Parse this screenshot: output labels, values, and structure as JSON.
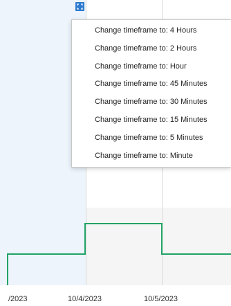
{
  "menu": {
    "items": [
      {
        "label": "Change timeframe to: 4 Hours"
      },
      {
        "label": "Change timeframe to: 2 Hours"
      },
      {
        "label": "Change timeframe to: Hour"
      },
      {
        "label": "Change timeframe to: 45 Minutes"
      },
      {
        "label": "Change timeframe to: 30 Minutes"
      },
      {
        "label": "Change timeframe to: 15 Minutes"
      },
      {
        "label": "Change timeframe to: 5 Minutes"
      },
      {
        "label": "Change timeframe to: Minute"
      }
    ]
  },
  "axis": {
    "x_ticks": [
      "/2023",
      "10/4/2023",
      "10/5/2023"
    ]
  },
  "icons": {
    "selection_handle": "expand-icon"
  },
  "colors": {
    "trace": "#21a366",
    "selection": "#edf4fb",
    "handle": "#2e7bcf"
  }
}
